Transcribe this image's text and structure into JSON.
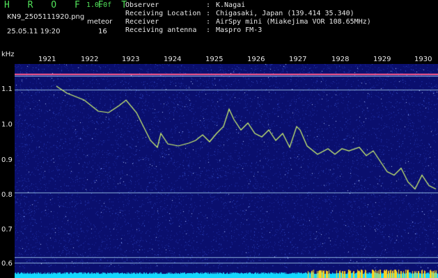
{
  "header": {
    "title": "H R O F F T",
    "version": "1.0.0f",
    "filename": "KN9_2505111920.png",
    "mode": "meteor",
    "datetime": "25.05.11 19:20",
    "count": "16"
  },
  "info": [
    {
      "key": "Observer",
      "value": "K.Nagai"
    },
    {
      "key": "Receiving Location",
      "value": "Chigasaki, Japan (139.414 35.340)"
    },
    {
      "key": "Receiver",
      "value": "AirSpy mini (Miakejima VOR 108.65MHz)"
    },
    {
      "key": "Receiving antenna",
      "value": "Maspro FM-3"
    }
  ],
  "axis": {
    "unit": "kHz",
    "y_labels": [
      "1.1",
      "1.0",
      "0.9",
      "0.8",
      "0.7",
      "0.6"
    ],
    "x_labels": [
      "1921",
      "1922",
      "1923",
      "1924",
      "1925",
      "1926",
      "1927",
      "1928",
      "1929",
      "1930"
    ]
  },
  "colors": {
    "background": "#000000",
    "spectrum": "#0a0f6e",
    "title": "#52e35a",
    "trace": "#d8ff70",
    "carrier": "#ff5a8c",
    "level": "#14d8ff",
    "level_peak": "#ffd21e"
  }
}
